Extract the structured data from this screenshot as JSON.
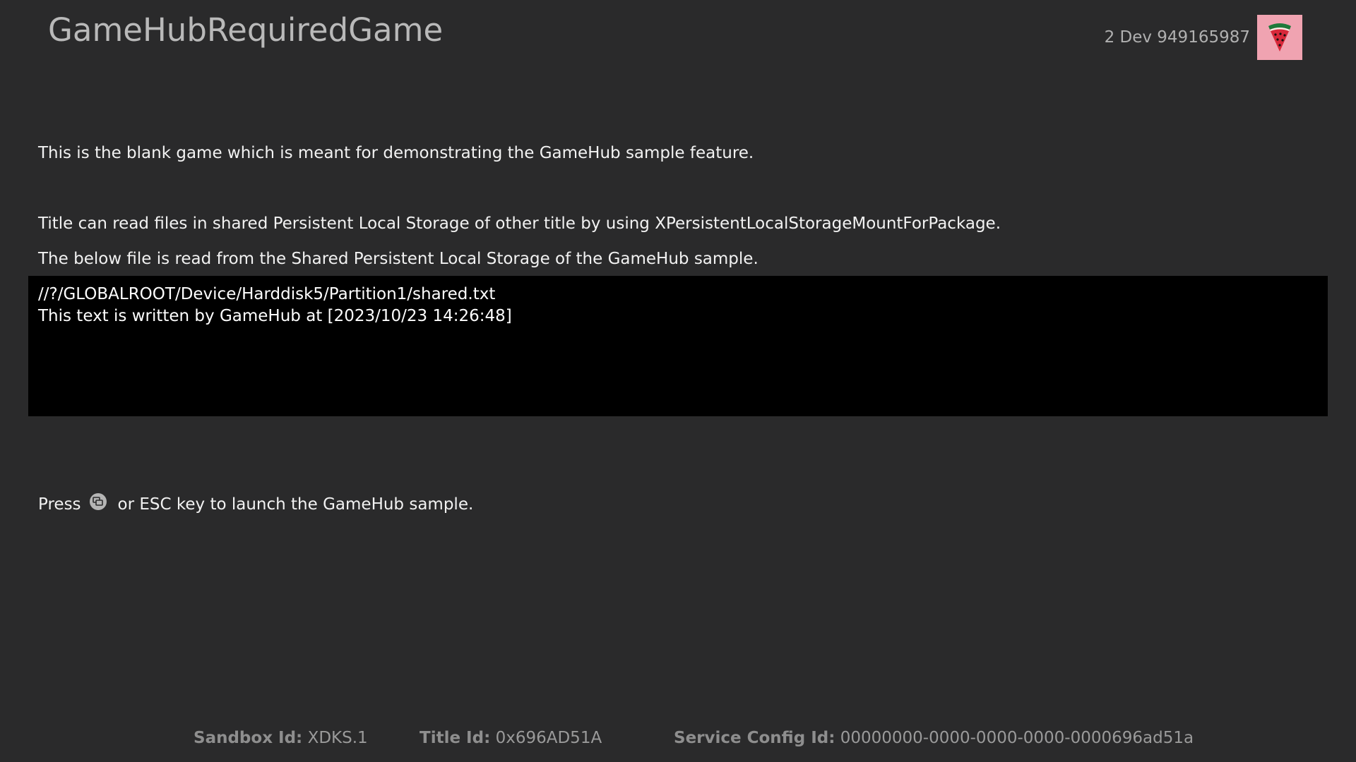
{
  "header": {
    "title": "GameHubRequiredGame",
    "gamertag": "2 Dev 949165987",
    "avatar_icon": "watermelon-icon",
    "avatar_bg": "#f0a3b1"
  },
  "content": {
    "line1": "This is the blank game which is meant for demonstrating the GameHub sample feature.",
    "line2": "Title can read files in shared Persistent Local Storage of other title by using XPersistentLocalStorageMountForPackage.",
    "line3": "The below file is read from the Shared Persistent Local Storage of the GameHub sample.",
    "file_path": "//?/GLOBALROOT/Device/Harddisk5/Partition1/shared.txt",
    "file_content": "This text is written by GameHub at [2023/10/23 14:26:48]",
    "press_prefix": "Press",
    "press_icon": "view-button-icon",
    "press_suffix": "or ESC key to launch the GameHub sample."
  },
  "footer": {
    "sandbox_label": "Sandbox Id:",
    "sandbox_value": "XDKS.1",
    "title_label": "Title Id:",
    "title_value": "0x696AD51A",
    "scid_label": "Service Config Id:",
    "scid_value": "00000000-0000-0000-0000-0000696ad51a"
  }
}
